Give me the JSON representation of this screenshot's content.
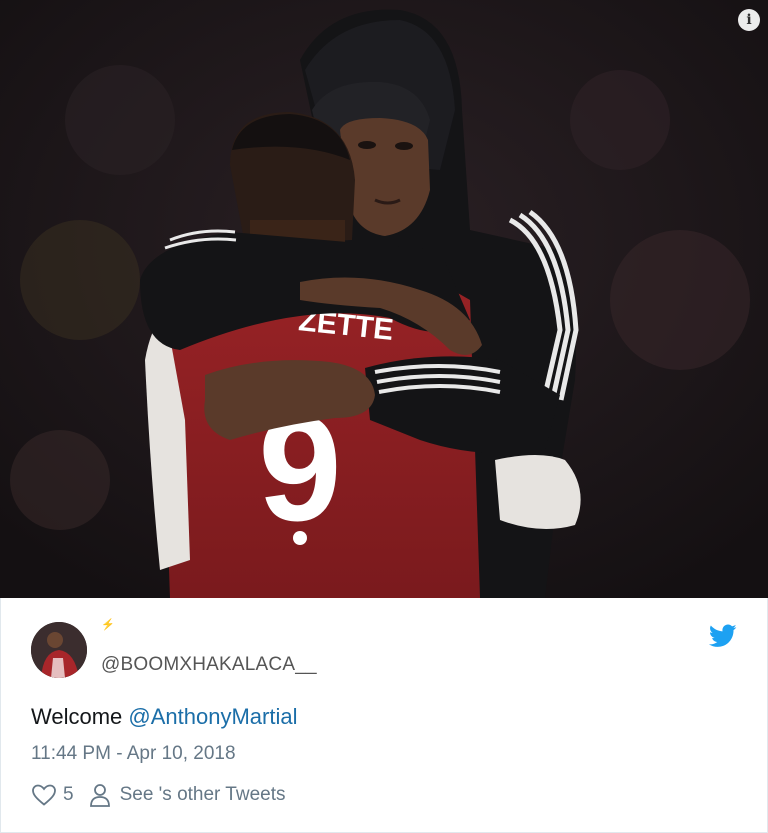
{
  "tweet": {
    "display_name": "⚡",
    "handle": "@BOOMXHAKALACA__",
    "text_prefix": "Welcome",
    "mention": "@AnthonyMartial",
    "timestamp": "11:44 PM - Apr 10, 2018",
    "likes": "5",
    "other_tweets_label": "See 's other Tweets"
  },
  "photo": {
    "jersey_name": "ZETTE",
    "jersey_number": "9"
  },
  "icons": {
    "info": "info-icon",
    "twitter": "twitter-bird-icon",
    "heart": "heart-icon",
    "person": "person-icon"
  },
  "colors": {
    "twitter_blue": "#1da1f2",
    "mention": "#1b6ea8",
    "muted": "#657786",
    "jersey_red": "#8e1f22"
  }
}
